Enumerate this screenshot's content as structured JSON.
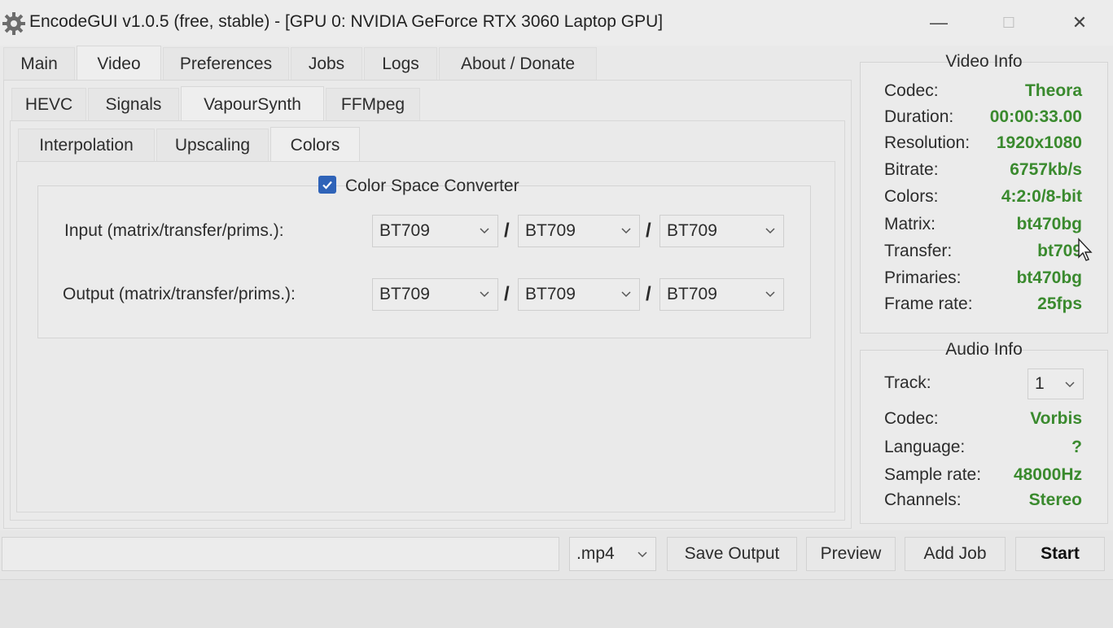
{
  "window": {
    "title": "EncodeGUI v1.0.5 (free, stable) - [GPU 0: NVIDIA GeForce RTX 3060 Laptop GPU]",
    "minimize": "—",
    "maximize": "☐",
    "close": "✕"
  },
  "main_tabs": [
    "Main",
    "Video",
    "Preferences",
    "Jobs",
    "Logs",
    "About / Donate"
  ],
  "sub_tabs_1": [
    "HEVC",
    "Signals",
    "VapourSynth",
    "FFMpeg"
  ],
  "sub_tabs_2": [
    "Interpolation",
    "Upscaling",
    "Colors"
  ],
  "colors": {
    "csc_label": "Color Space Converter",
    "csc_checked": true,
    "input_label": "Input (matrix/transfer/prims.):",
    "output_label": "Output (matrix/transfer/prims.):",
    "input": [
      "BT709",
      "BT709",
      "BT709"
    ],
    "output": [
      "BT709",
      "BT709",
      "BT709"
    ],
    "separator": "/"
  },
  "video_info": {
    "title": "Video Info",
    "rows": [
      {
        "label": "Codec:",
        "value": "Theora"
      },
      {
        "label": "Duration:",
        "value": "00:00:33.00"
      },
      {
        "label": "Resolution:",
        "value": "1920x1080"
      },
      {
        "label": "Bitrate:",
        "value": "6757kb/s"
      },
      {
        "label": "Colors:",
        "value": "4:2:0/8-bit"
      },
      {
        "label": "Matrix:",
        "value": "bt470bg"
      },
      {
        "label": "Transfer:",
        "value": "bt709"
      },
      {
        "label": "Primaries:",
        "value": "bt470bg"
      },
      {
        "label": "Frame rate:",
        "value": "25fps"
      }
    ]
  },
  "audio_info": {
    "title": "Audio Info",
    "track_label": "Track:",
    "track_value": "1",
    "rows": [
      {
        "label": "Codec:",
        "value": "Vorbis"
      },
      {
        "label": "Language:",
        "value": "?"
      },
      {
        "label": "Sample rate:",
        "value": "48000Hz"
      },
      {
        "label": "Channels:",
        "value": "Stereo"
      }
    ]
  },
  "bottom": {
    "output_path": "",
    "format": ".mp4",
    "save_output": "Save Output",
    "preview": "Preview",
    "add_job": "Add Job",
    "start": "Start"
  },
  "accent": {
    "checkbox": "#2f63b8",
    "value_green": "#3a8a2e"
  }
}
